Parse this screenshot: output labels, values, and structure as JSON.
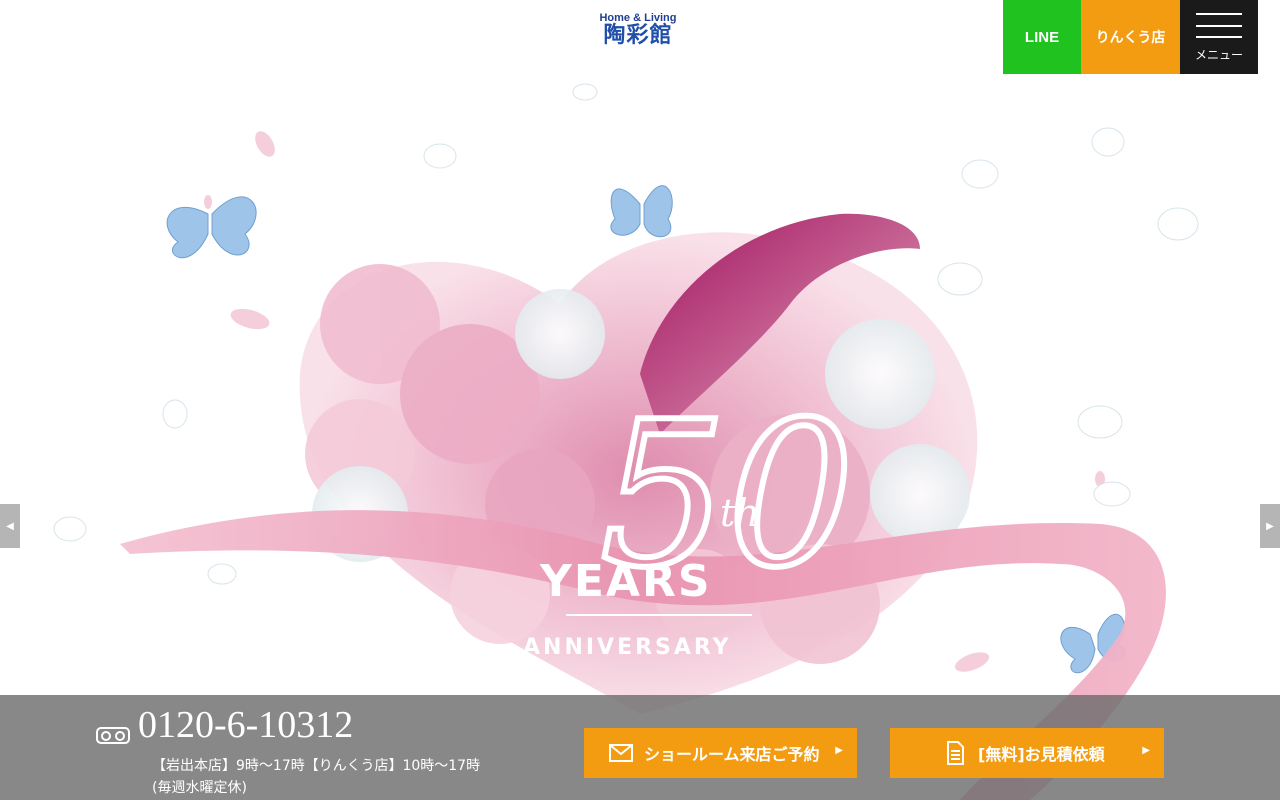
{
  "header": {
    "logo_sub": "Home & Living",
    "logo_main": "陶彩館",
    "line_label": "LINE",
    "rinku_label": "りんくう店",
    "menu_label": "メニュー"
  },
  "hero": {
    "number_text": "50",
    "suffix_text": "th",
    "years_text": "YEARS",
    "anniversary_text": "ANNIVERSARY"
  },
  "bottom_bar": {
    "phone_number": "0120-6-10312",
    "hours_line1": "【岩出本店】9時～17時【りんくう店】10時～17時",
    "hours_line2": "(毎週水曜定休)",
    "cta_showroom": "ショールーム来店ご予約",
    "cta_estimate": "[無料]お見積依頼"
  },
  "colors": {
    "line_green": "#1fc21f",
    "accent_orange": "#f39c12",
    "menu_dark": "#1a1a1a",
    "logo_blue": "#1f4fa8",
    "ribbon_pink": "#e8a0b8"
  },
  "icons": {
    "menu": "hamburger-icon",
    "mail": "mail-icon",
    "document": "document-icon",
    "freedial": "freedial-icon",
    "prev": "chevron-left-icon",
    "next": "chevron-right-icon"
  }
}
